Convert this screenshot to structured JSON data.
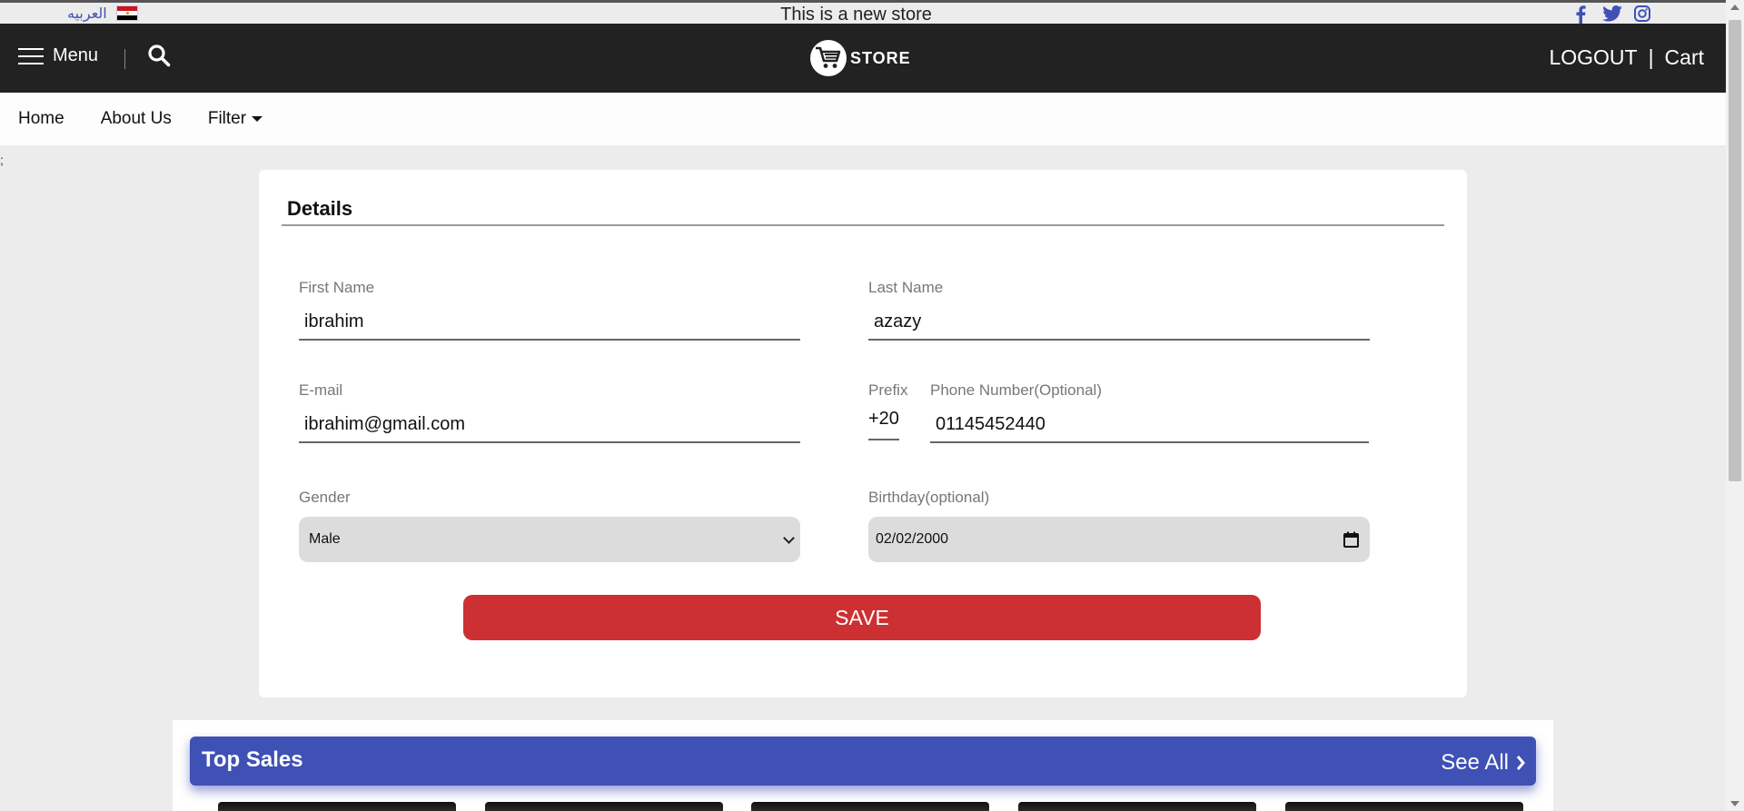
{
  "announcement": {
    "language_link": "العربيه",
    "text": "This is a new store",
    "social_icons": [
      "facebook-icon",
      "twitter-icon",
      "instagram-icon"
    ]
  },
  "header": {
    "menu_label": "Menu",
    "logo_text": "STORE",
    "logout_label": "LOGOUT",
    "separator": "|",
    "cart_label": "Cart"
  },
  "nav": {
    "items": [
      {
        "label": "Home"
      },
      {
        "label": "About Us"
      },
      {
        "label": "Filter"
      }
    ]
  },
  "stray_text": ";",
  "details": {
    "title": "Details",
    "first_name": {
      "label": "First Name",
      "value": "ibrahim"
    },
    "last_name": {
      "label": "Last Name",
      "value": "azazy"
    },
    "email": {
      "label": "E-mail",
      "value": "ibrahim@gmail.com"
    },
    "prefix": {
      "label": "Prefix",
      "value": "+20"
    },
    "phone": {
      "label": "Phone Number(Optional)",
      "value": "01145452440"
    },
    "gender": {
      "label": "Gender",
      "value": "Male"
    },
    "birthday": {
      "label": "Birthday(optional)",
      "value": "02/02/2000"
    },
    "save_label": "SAVE"
  },
  "top_sales": {
    "title": "Top Sales",
    "see_all_label": "See All"
  },
  "colors": {
    "header_bg": "#222222",
    "accent_blue": "#3f51b5",
    "save_red": "#cc3033"
  }
}
